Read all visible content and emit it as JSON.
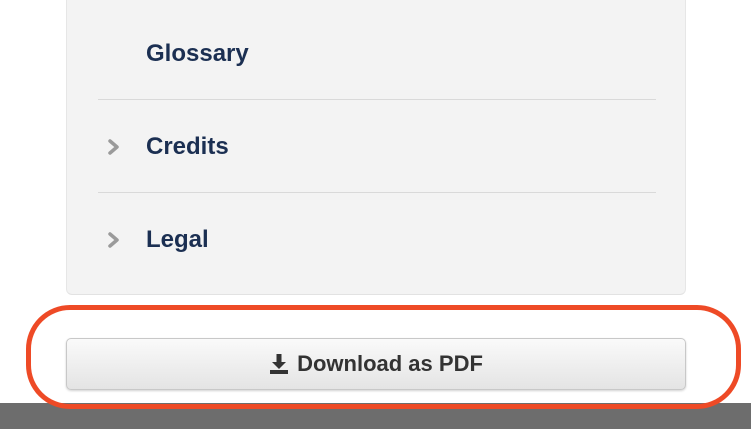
{
  "nav": {
    "items": [
      {
        "label": "Glossary",
        "has_chevron": false,
        "icon": "none"
      },
      {
        "label": "Credits",
        "has_chevron": true,
        "icon": "chevron-right-icon"
      },
      {
        "label": "Legal",
        "has_chevron": true,
        "icon": "chevron-right-icon"
      }
    ]
  },
  "download": {
    "label": "Download as PDF",
    "icon": "download-icon"
  },
  "colors": {
    "link_text": "#1b2f52",
    "highlight_ring": "#ee4a26",
    "footer": "#6d6d6d"
  }
}
